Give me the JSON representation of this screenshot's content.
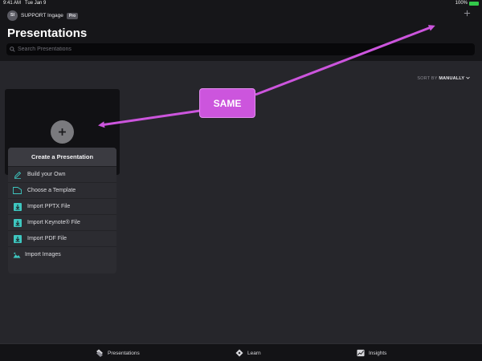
{
  "status": {
    "time": "9:41 AM",
    "date": "Tue Jan 9",
    "battery_percent": "100%"
  },
  "header": {
    "avatar_initials": "SI",
    "account_name": "SUPPORT Ingage",
    "badge": "Pro",
    "add_icon": "plus-icon",
    "title": "Presentations"
  },
  "search": {
    "placeholder": "Search Presentations",
    "value": ""
  },
  "sort": {
    "label": "SORT BY",
    "value": "MANUALLY"
  },
  "popover": {
    "title": "Create a Presentation",
    "items": [
      {
        "label": "Build your Own",
        "icon": "pencil-icon"
      },
      {
        "label": "Choose a Template",
        "icon": "template-icon"
      },
      {
        "label": "Import PPTX File",
        "icon": "import-icon"
      },
      {
        "label": "Import Keynote® File",
        "icon": "import-icon"
      },
      {
        "label": "Import PDF File",
        "icon": "import-icon"
      },
      {
        "label": "Import Images",
        "icon": "image-icon"
      }
    ]
  },
  "callout": {
    "text": "SAME",
    "color": "#cc55dd"
  },
  "tabs": [
    {
      "label": "Presentations",
      "icon": "presentations-icon"
    },
    {
      "label": "Learn",
      "icon": "learn-icon"
    },
    {
      "label": "Insights",
      "icon": "insights-icon"
    }
  ],
  "colors": {
    "accent": "#3ec7c0",
    "annotation": "#cc55dd",
    "background": "#26262b"
  }
}
